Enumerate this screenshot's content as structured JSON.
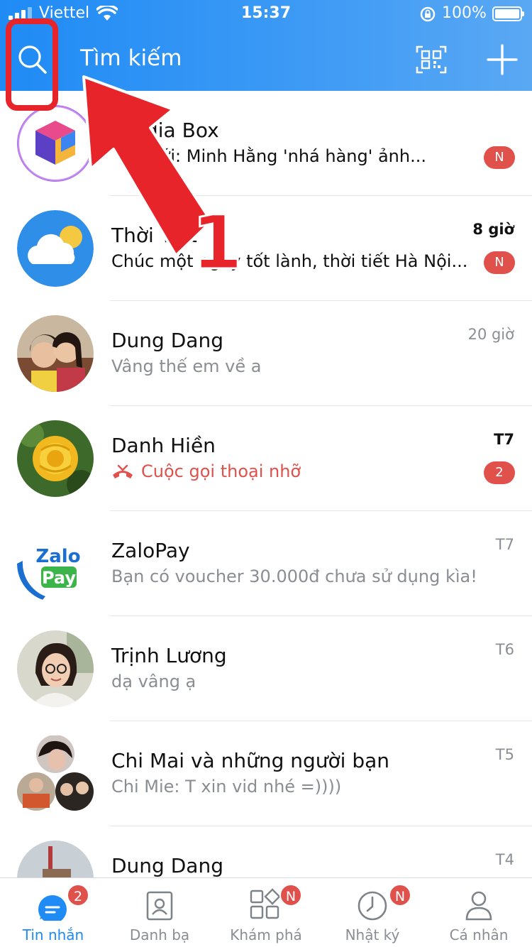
{
  "status_bar": {
    "carrier": "Viettel",
    "time": "15:37",
    "battery": "100%"
  },
  "header": {
    "search_label": "Tìm kiếm",
    "icons": [
      "search-icon",
      "qr-code-icon",
      "plus-icon"
    ],
    "accent_color": "#1f8bf5"
  },
  "conversations": [
    {
      "name": "dia Box",
      "preview": "Mới: Minh Hằng 'nhá hàng' ảnh...",
      "time": "",
      "badge": "N",
      "unread": false
    },
    {
      "name": "Thời Tiết",
      "preview": "Chúc một ngày tốt lành, thời tiết Hà Nội...",
      "time": "8 giờ",
      "badge": "N",
      "unread": true
    },
    {
      "name": "Dung Dang",
      "preview": "Vâng thế em về a",
      "time": "20 giờ",
      "badge": "",
      "unread": false
    },
    {
      "name": "Danh Hiền",
      "preview": "Cuộc gọi thoại nhỡ",
      "time": "T7",
      "badge": "2",
      "unread": true,
      "missed_call": true
    },
    {
      "name": "ZaloPay",
      "preview": "Bạn có voucher 30.000đ chưa sử dụng kìa!",
      "time": "T7",
      "badge": "",
      "unread": false
    },
    {
      "name": "Trịnh Lương",
      "preview": "dạ vâng ạ",
      "time": "T6",
      "badge": "",
      "unread": false
    },
    {
      "name": "Chi Mai và những người bạn",
      "preview": "Chi Mie: T xin vid nhé =))))",
      "time": "T5",
      "badge": "",
      "unread": false
    },
    {
      "name": "Dung Dang",
      "preview": "",
      "time": "T4",
      "badge": "",
      "unread": false
    }
  ],
  "zalopay_logo": {
    "line1": "Zalo",
    "line2": "Pay"
  },
  "tabs": [
    {
      "label": "Tin nhắn",
      "badge": "2",
      "icon": "chat-icon",
      "active": true
    },
    {
      "label": "Danh bạ",
      "badge": "",
      "icon": "contacts-icon",
      "active": false
    },
    {
      "label": "Khám phá",
      "badge": "N",
      "icon": "discover-grid-icon",
      "active": false
    },
    {
      "label": "Nhật ký",
      "badge": "N",
      "icon": "clock-icon",
      "active": false
    },
    {
      "label": "Cá nhân",
      "badge": "",
      "icon": "person-icon",
      "active": false
    }
  ],
  "annotation": {
    "step_number": "1",
    "color": "#e8242b"
  }
}
